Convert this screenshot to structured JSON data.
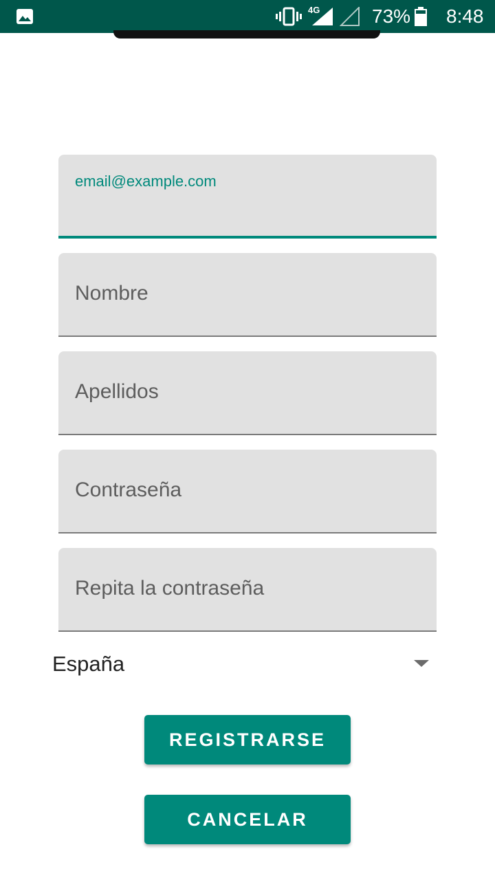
{
  "status_bar": {
    "network": "4G",
    "battery": "73%",
    "time": "8:48"
  },
  "form": {
    "email": {
      "label": "email@example.com",
      "value": ""
    },
    "nombre": {
      "placeholder": "Nombre"
    },
    "apellidos": {
      "placeholder": "Apellidos"
    },
    "password": {
      "placeholder": "Contraseña"
    },
    "password_repeat": {
      "placeholder": "Repita la contraseña"
    },
    "country": {
      "selected": "España"
    }
  },
  "buttons": {
    "register": "REGISTRARSE",
    "cancel": "CANCELAR"
  },
  "colors": {
    "accent": "#00897b",
    "status_bar": "#00574b",
    "field_bg": "#e1e1e1"
  }
}
